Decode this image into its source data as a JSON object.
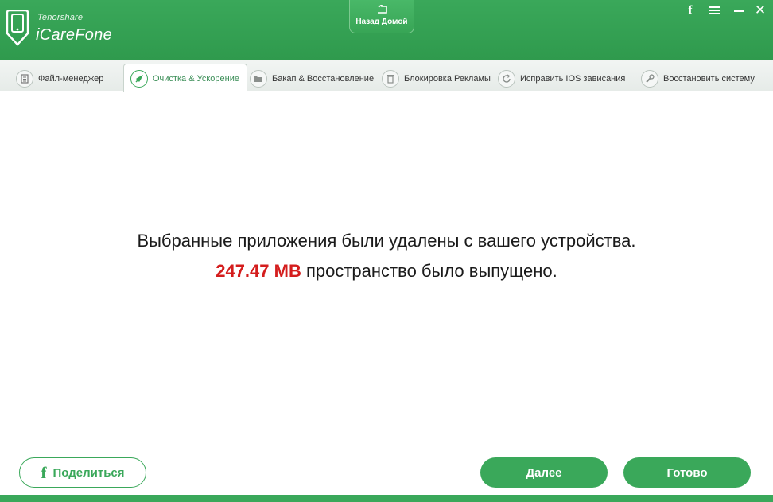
{
  "header": {
    "brand_small": "Tenorshare",
    "brand_big": "iCareFone",
    "home_label": "Назад Домой",
    "controls": {
      "facebook_glyph": "f",
      "close_glyph": "✕"
    }
  },
  "tabs": [
    {
      "label": "Файл-менеджер",
      "icon": "file-manager-icon",
      "active": false
    },
    {
      "label": "Очистка & Ускорение",
      "icon": "rocket-icon",
      "active": true
    },
    {
      "label": "Бакап & Восстановление",
      "icon": "folder-icon",
      "active": false
    },
    {
      "label": "Блокировка Рекламы",
      "icon": "trash-icon",
      "active": false
    },
    {
      "label": "Исправить IOS зависания",
      "icon": "refresh-icon",
      "active": false
    },
    {
      "label": "Восстановить систему",
      "icon": "wrench-icon",
      "active": false
    }
  ],
  "main": {
    "message_line1": "Выбранные приложения были удалены с вашего устройства.",
    "freed_amount": "247.47 MB",
    "message_line2_suffix": "пространство было выпущено."
  },
  "footer": {
    "share_glyph": "f",
    "share_label": "Поделиться",
    "next_label": "Далее",
    "done_label": "Готово"
  },
  "colors": {
    "brand_green": "#3aa85a",
    "freed_red": "#d41d1d"
  }
}
